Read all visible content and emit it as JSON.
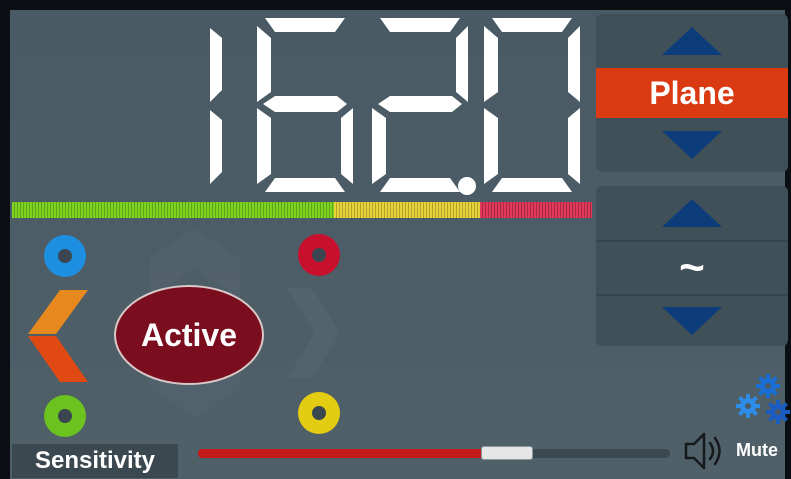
{
  "display": {
    "value": "162.0"
  },
  "level_meter": {
    "zones": [
      "green",
      "yellow",
      "red"
    ]
  },
  "mode": {
    "label": "Plane"
  },
  "filter": {
    "label": "~"
  },
  "status": {
    "label": "Active"
  },
  "sensitivity": {
    "label": "Sensitivity",
    "level": 0.61
  },
  "mute": {
    "label": "Mute"
  },
  "colors": {
    "background": "#4b5b65",
    "accent_orange": "#d93a12",
    "arrow_blue": "#0d3c7a",
    "status_dark_red": "#7a0d1e",
    "ring_blue": "#1e8fe0",
    "ring_red": "#c8102e",
    "ring_green": "#6cc21e",
    "ring_yellow": "#e3cc12",
    "slider_red": "#c41a1a"
  },
  "icons": [
    "chevron-left-icon",
    "chevron-right-icon",
    "speaker-icon",
    "gears-icon"
  ]
}
